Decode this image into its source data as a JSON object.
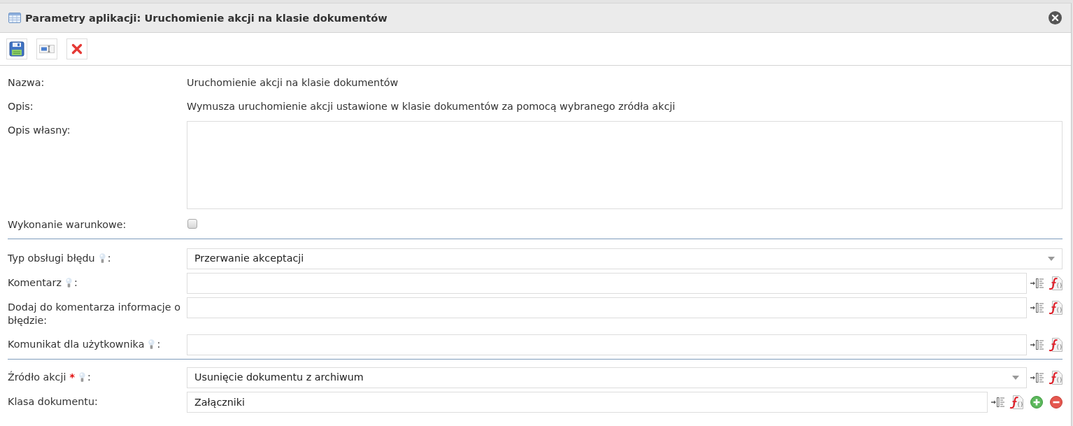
{
  "window": {
    "title": "Parametry aplikacji: Uruchomienie akcji na klasie dokumentów"
  },
  "sections": [
    {
      "fields": [
        {
          "kind": "text",
          "label": "Nazwa:",
          "hint": false,
          "value": "Uruchomienie akcji na klasie dokumentów"
        },
        {
          "kind": "text",
          "label": "Opis:",
          "hint": false,
          "value": "Wymusza uruchomienie akcji ustawione w klasie dokumentów za pomocą wybranego zródła akcji"
        },
        {
          "kind": "textarea",
          "label": "Opis własny:",
          "hint": false
        },
        {
          "kind": "checkbox",
          "label": "Wykonanie warunkowe:",
          "hint": false,
          "checked": false
        }
      ]
    },
    {
      "fields": [
        {
          "kind": "select",
          "label": "Typ obsługi błędu",
          "hint": true,
          "suffix": ":",
          "value": "Przerwanie akceptacji"
        },
        {
          "kind": "input",
          "label": "Komentarz",
          "hint": true,
          "suffix": ":",
          "buttons": [
            {
              "kind": "insert"
            },
            {
              "kind": "formula"
            }
          ]
        },
        {
          "kind": "input",
          "label": "Dodaj do komentarza informacje o błędzie:",
          "hint": false,
          "buttons": [
            {
              "kind": "insert"
            },
            {
              "kind": "formula"
            }
          ]
        },
        {
          "kind": "input",
          "label": "Komunikat dla użytkownika",
          "hint": true,
          "suffix": ":",
          "buttons": [
            {
              "kind": "insert"
            },
            {
              "kind": "formula"
            }
          ]
        }
      ]
    },
    {
      "fields": [
        {
          "kind": "select",
          "label": "Źródło akcji",
          "required_mark": "*",
          "hint": true,
          "suffix": ":",
          "value": "Usunięcie dokumentu z archiwum",
          "buttons": [
            {
              "kind": "insert"
            },
            {
              "kind": "formula"
            }
          ]
        },
        {
          "kind": "input",
          "label": "Klasa dokumentu:",
          "hint": false,
          "value": "Załączniki",
          "buttons": [
            {
              "kind": "insert"
            },
            {
              "kind": "formula"
            },
            {
              "kind": "add"
            },
            {
              "kind": "remove"
            }
          ]
        }
      ]
    }
  ]
}
